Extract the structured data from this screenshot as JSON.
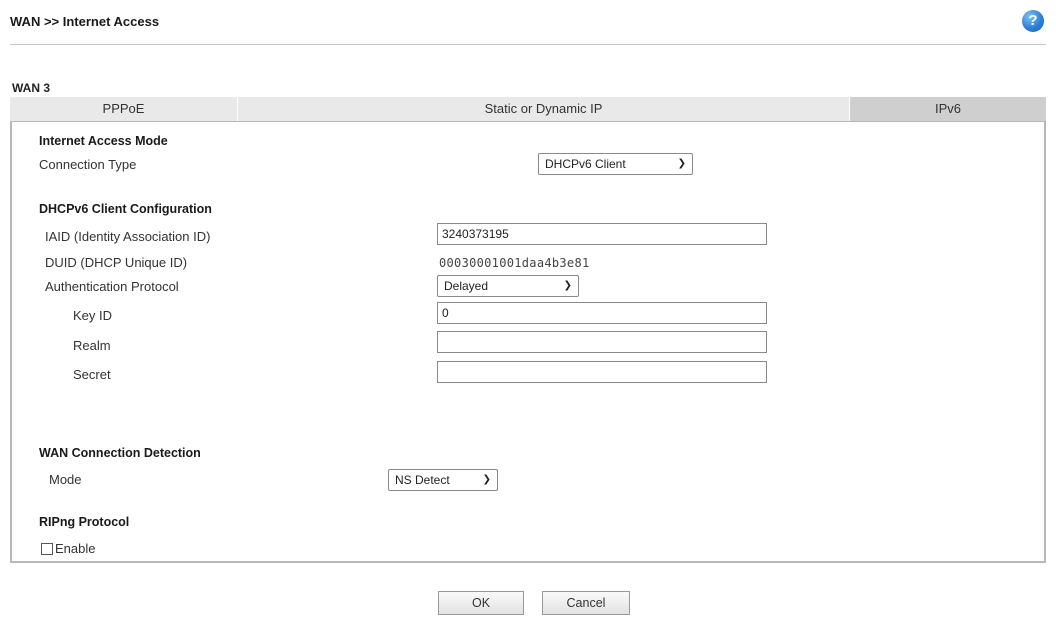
{
  "header": {
    "title": "WAN >> Internet Access",
    "help_glyph": "?"
  },
  "wan": {
    "label": "WAN 3"
  },
  "tabs": [
    {
      "label": "PPPoE",
      "active": false
    },
    {
      "label": "Static or Dynamic IP",
      "active": false
    },
    {
      "label": "IPv6",
      "active": true
    }
  ],
  "access_mode": {
    "heading": "Internet Access Mode",
    "connection_type_label": "Connection Type",
    "connection_type_value": "DHCPv6 Client"
  },
  "dhcpv6": {
    "heading": "DHCPv6 Client Configuration",
    "iaid_label": "IAID (Identity Association ID)",
    "iaid_value": "3240373195",
    "duid_label": "DUID (DHCP Unique ID)",
    "duid_value": "00030001001daa4b3e81",
    "auth_label": "Authentication Protocol",
    "auth_value": "Delayed",
    "key_id_label": "Key ID",
    "key_id_value": "0",
    "realm_label": "Realm",
    "realm_value": "",
    "secret_label": "Secret",
    "secret_value": ""
  },
  "detection": {
    "heading": "WAN Connection Detection",
    "mode_label": "Mode",
    "mode_value": "NS Detect"
  },
  "ripng": {
    "heading": "RIPng Protocol",
    "enable_label": "Enable",
    "enabled": false
  },
  "buttons": {
    "ok": "OK",
    "cancel": "Cancel"
  }
}
